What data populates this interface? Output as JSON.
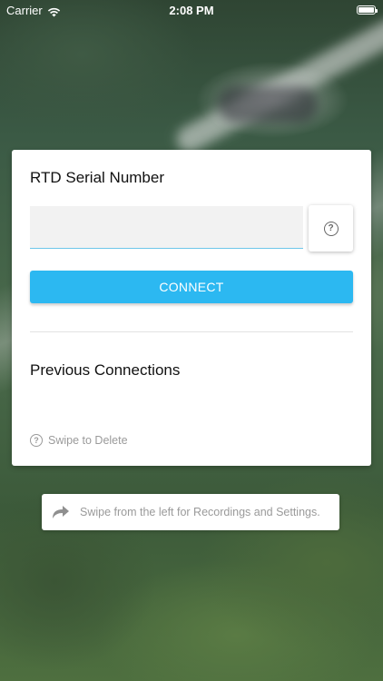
{
  "status_bar": {
    "carrier": "Carrier",
    "time": "2:08 PM"
  },
  "card": {
    "title": "RTD Serial Number",
    "serial_input": {
      "value": "",
      "placeholder": ""
    },
    "help_icon": "question-circle-icon",
    "connect_label": "CONNECT",
    "previous_title": "Previous Connections",
    "swipe_hint": "Swipe to Delete"
  },
  "tip": {
    "icon": "share-arrow-icon",
    "text": "Swipe from the left for Recordings and Settings."
  },
  "colors": {
    "accent": "#2cb8f1",
    "card_background": "#ffffff",
    "hint_text": "#9a9a9a"
  }
}
